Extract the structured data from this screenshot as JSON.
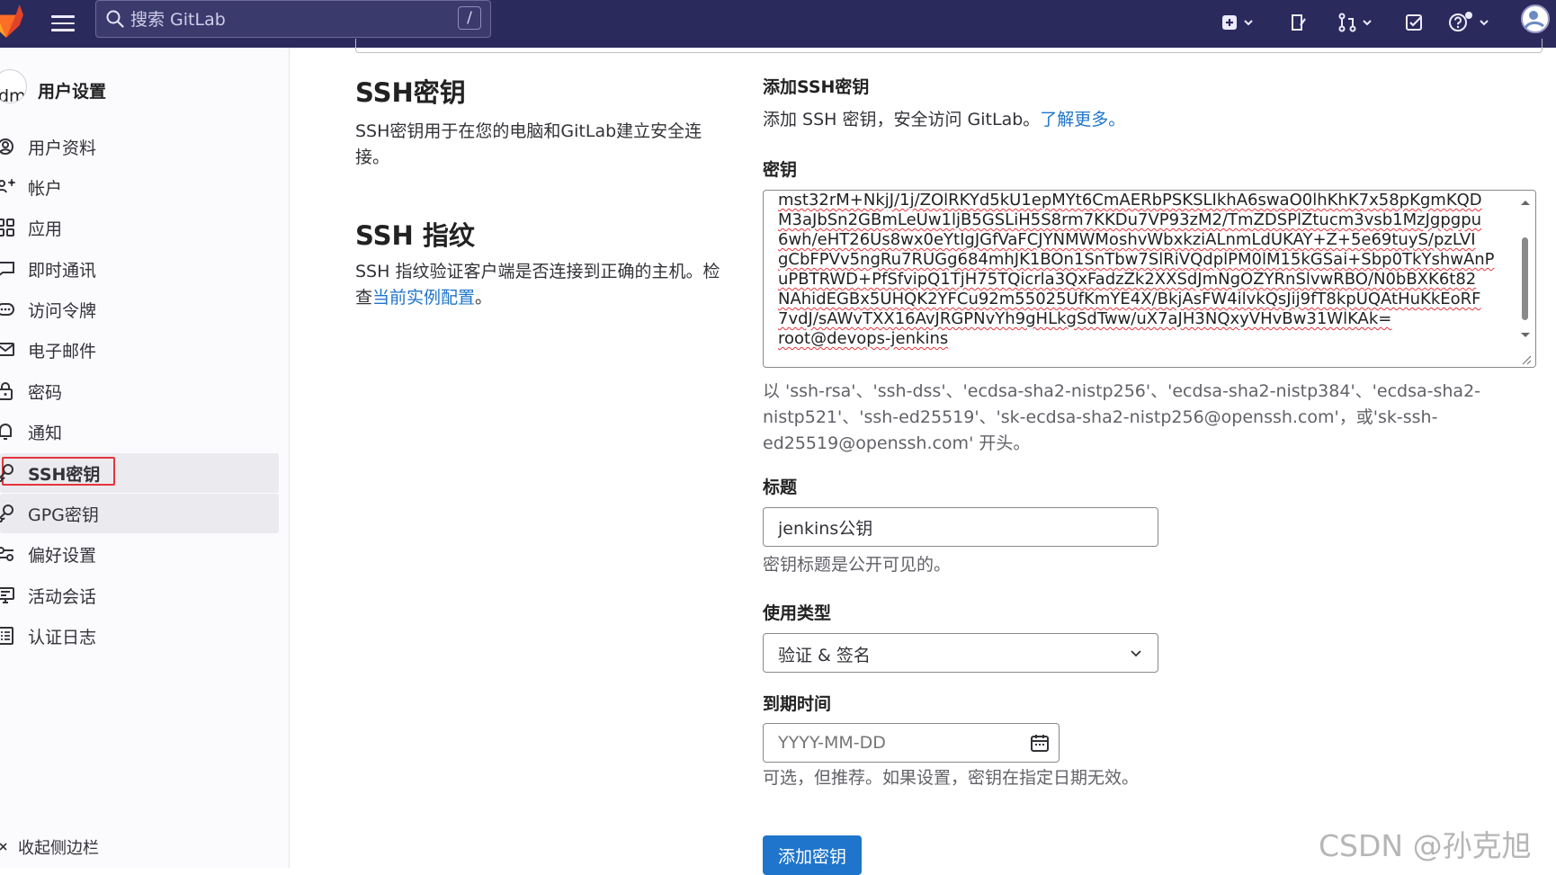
{
  "topbar": {
    "search_placeholder": "搜索 GitLab",
    "search_shortcut": "/"
  },
  "sidebar": {
    "title": "用户设置",
    "avatar_text": "dm",
    "items": [
      {
        "label": "用户资料",
        "icon": "user-circle-icon"
      },
      {
        "label": "帐户",
        "icon": "account-icon"
      },
      {
        "label": "应用",
        "icon": "applications-icon"
      },
      {
        "label": "即时通讯",
        "icon": "comment-icon"
      },
      {
        "label": "访问令牌",
        "icon": "token-icon"
      },
      {
        "label": "电子邮件",
        "icon": "mail-icon"
      },
      {
        "label": "密码",
        "icon": "lock-icon"
      },
      {
        "label": "通知",
        "icon": "bell-icon"
      },
      {
        "label": "SSH密钥",
        "icon": "key-icon",
        "active": true
      },
      {
        "label": "GPG密钥",
        "icon": "key-icon"
      },
      {
        "label": "偏好设置",
        "icon": "preferences-icon"
      },
      {
        "label": "活动会话",
        "icon": "monitor-icon"
      },
      {
        "label": "认证日志",
        "icon": "log-icon"
      }
    ],
    "collapse_label": "收起侧边栏"
  },
  "main": {
    "ssh_keys_heading": "SSH密钥",
    "ssh_keys_desc": "SSH密钥用于在您的电脑和GitLab建立安全连接。",
    "fingerprint_heading": "SSH 指纹",
    "fingerprint_desc": "SSH 指纹验证客户端是否连接到正确的主机。检查",
    "fingerprint_link": "当前实例配置",
    "fingerprint_desc_end": "。"
  },
  "form": {
    "heading": "添加SSH密钥",
    "intro": "添加 SSH 密钥，安全访问 GitLab。",
    "intro_link": "了解更多。",
    "key_label": "密钥",
    "key_lines": [
      "mst32rM+NkjJ/1j/ZOlRKYd5kU1epMYt6CmAERbPSKSLIkhA6swaO0lhKhK7x58pKgmKQD",
      "M3aJbSn2GBmLeUw1ljB5GSLiH5S8rm7KKDu7VP93zM2/TmZDSPlZtucm3vsb1MzJgpgpu",
      "6wh/eHT26Us8wx0eYtIgJGfVaFCJYNMWMoshvWbxkziALnmLdUKAY+Z+5e69tuyS/pzLVI",
      "gCbFPVv5ngRu7RUGg684mhJK1BOn1SnTbw7SlRiVQdplPM0lM15kGSai+Sbp0TkYshwAnP",
      "uPBTRWD+PfSfvipQ1TjH75TQicrla3QxFadzZk2XXSdJmNgOZYRnSlvwRBO/N0bBXK6t82",
      "NAhidEGBx5UHQK2YFCu92m55025UfKmYE4X/BkjAsFW4ilvkQsJij9fT8kpUQAtHuKkEoRF",
      "7vdJ/sAWvTXX16AvJRGPNvYh9gHLkgSdTww/uX7aJH3NQxyVHvBw31WlKAk=",
      "root@devops-jenkins"
    ],
    "key_help": "以 'ssh-rsa'、'ssh-dss'、'ecdsa-sha2-nistp256'、'ecdsa-sha2-nistp384'、'ecdsa-sha2-nistp521'、'ssh-ed25519'、'sk-ecdsa-sha2-nistp256@openssh.com'，或'sk-ssh-ed25519@openssh.com' 开头。",
    "title_label": "标题",
    "title_value": "jenkins公钥",
    "title_help": "密钥标题是公开可见的。",
    "usage_label": "使用类型",
    "usage_value": "验证 & 签名",
    "expiry_label": "到期时间",
    "expiry_placeholder": "YYYY-MM-DD",
    "expiry_help": "可选，但推荐。如果设置，密钥在指定日期无效。",
    "submit_label": "添加密钥"
  },
  "watermark": "CSDN @孙克旭",
  "colors": {
    "topbar_bg": "#2b2a5c",
    "link": "#1f75cb",
    "button_bg": "#1f75cb",
    "highlight_box": "#e5343c"
  }
}
